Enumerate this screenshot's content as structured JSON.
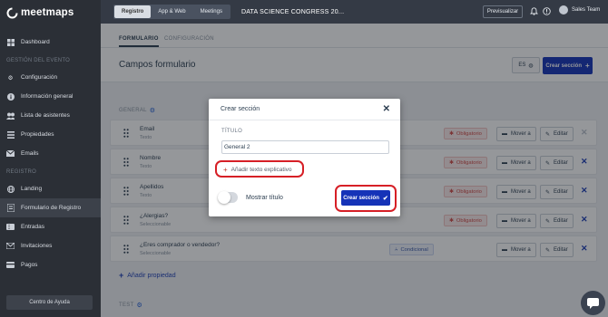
{
  "brand": {
    "name": "meetmaps"
  },
  "sidebar": {
    "items_top": [
      {
        "label": "Dashboard",
        "icon": "dashboard-icon"
      }
    ],
    "section1": "GESTIÓN DEL EVENTO",
    "items_event": [
      {
        "label": "Configuración",
        "icon": "gear-icon"
      },
      {
        "label": "Información general",
        "icon": "info-icon"
      },
      {
        "label": "Lista de asistentes",
        "icon": "users-icon"
      },
      {
        "label": "Propiedades",
        "icon": "list-icon"
      },
      {
        "label": "Emails",
        "icon": "mail-icon"
      }
    ],
    "section2": "REGISTRO",
    "items_registro": [
      {
        "label": "Landing",
        "icon": "globe-icon"
      },
      {
        "label": "Formulario de Registro",
        "icon": "form-icon"
      },
      {
        "label": "Entradas",
        "icon": "ticket-icon"
      },
      {
        "label": "Invitaciones",
        "icon": "envelope-icon"
      },
      {
        "label": "Pagos",
        "icon": "card-icon"
      }
    ],
    "help": "Centro de Ayuda"
  },
  "topbar": {
    "tabs": [
      "Registro",
      "App & Web",
      "Meetings"
    ],
    "event_title": "DATA SCIENCE CONGRESS 20...",
    "preview": "Previsualizar",
    "user": "Sales Team"
  },
  "subtabs": [
    "FORMULARIO",
    "CONFIGURACIÓN"
  ],
  "header": {
    "title": "Campos formulario",
    "lang": "ES",
    "create_section": "Crear sección"
  },
  "section_general": "GENERAL",
  "fields": [
    {
      "name": "Email",
      "type": "Texto",
      "tag": "Obligatorio"
    },
    {
      "name": "Nombre",
      "type": "Texto",
      "tag": "Obligatorio"
    },
    {
      "name": "Apellidos",
      "type": "Texto",
      "tag": "Obligatorio"
    },
    {
      "name": "¿Alergias?",
      "type": "Seleccionable",
      "tag": "Obligatorio"
    },
    {
      "name": "¿Eres comprador o vendedor?",
      "type": "Seleccionable",
      "tag": "Condicional"
    }
  ],
  "row_actions": {
    "move": "Mover a",
    "edit": "Editar"
  },
  "add_property": "Añadir propiedad",
  "section_test": "TEST",
  "modal": {
    "title": "Crear sección",
    "field_label": "TÍTULO",
    "input_value": "General 2",
    "add_text": "Añadir texto explicativo",
    "toggle_label": "Mostrar título",
    "submit": "Crear sección"
  },
  "colors": {
    "accent": "#1533b8",
    "sidebar": "#2b2f36",
    "highlight_ring": "#d61f26"
  }
}
